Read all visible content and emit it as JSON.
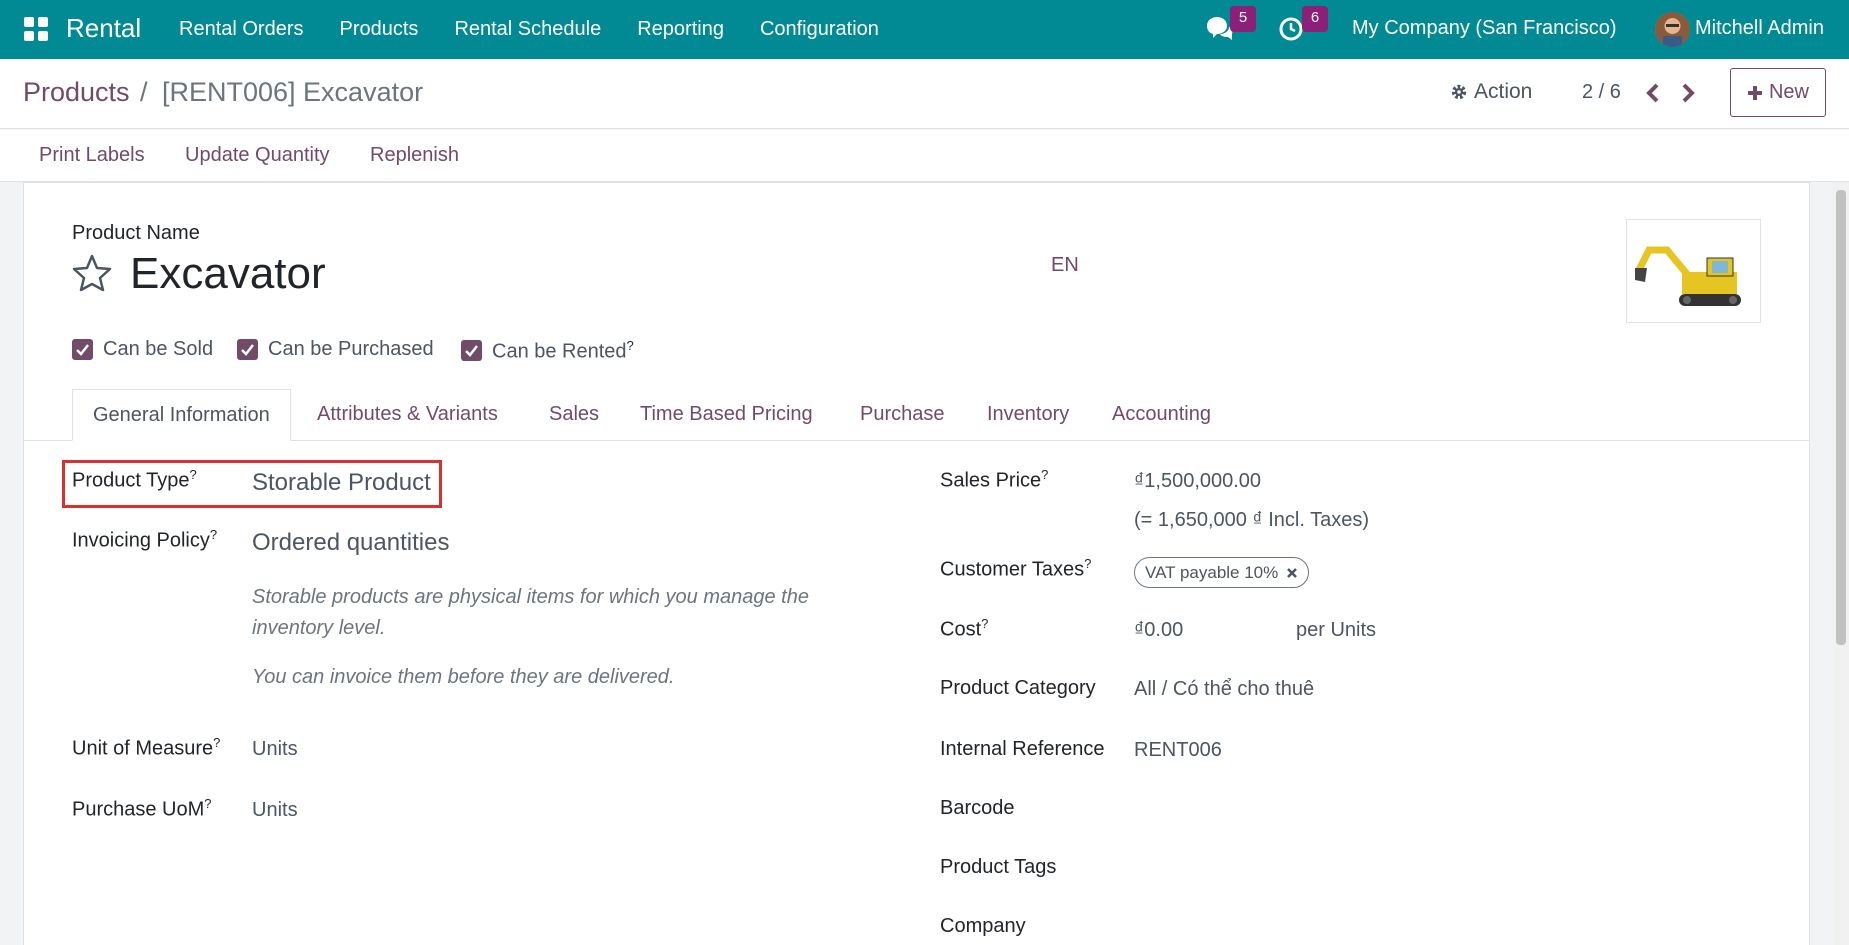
{
  "navbar": {
    "app_name": "Rental",
    "menu": [
      "Rental Orders",
      "Products",
      "Rental Schedule",
      "Reporting",
      "Configuration"
    ],
    "messages_count": "5",
    "activities_count": "6",
    "company": "My Company (San Francisco)",
    "user": "Mitchell Admin"
  },
  "control": {
    "breadcrumb_parent": "Products",
    "breadcrumb_sep": "/",
    "breadcrumb_current": "[RENT006] Excavator",
    "action_label": "Action",
    "pager": "2 / 6",
    "new_label": "New"
  },
  "statusbar": {
    "buttons": [
      "Print Labels",
      "Update Quantity",
      "Replenish"
    ]
  },
  "form": {
    "name_label": "Product Name",
    "name": "Excavator",
    "lang": "EN",
    "checkboxes": [
      {
        "label": "Can be Sold",
        "checked": true
      },
      {
        "label": "Can be Purchased",
        "checked": true
      },
      {
        "label": "Can be Rented",
        "checked": true,
        "help": "?"
      }
    ],
    "tabs": [
      "General Information",
      "Attributes & Variants",
      "Sales",
      "Time Based Pricing",
      "Purchase",
      "Inventory",
      "Accounting"
    ],
    "left": {
      "product_type_label": "Product Type",
      "product_type": "Storable Product",
      "invoicing_policy_label": "Invoicing Policy",
      "invoicing_policy": "Ordered quantities",
      "help_line1": "Storable products are physical items for which you manage the inventory level.",
      "help_line2": "You can invoice them before they are delivered.",
      "uom_label": "Unit of Measure",
      "uom": "Units",
      "purchase_uom_label": "Purchase UoM",
      "purchase_uom": "Units"
    },
    "right": {
      "sales_price_label": "Sales Price",
      "sales_price": "₫1,500,000.00",
      "incl_taxes": "(= 1,650,000 ₫ Incl. Taxes)",
      "customer_taxes_label": "Customer Taxes",
      "customer_tax_tag": "VAT payable 10%",
      "cost_label": "Cost",
      "cost": "₫0.00",
      "cost_unit": "per Units",
      "category_label": "Product Category",
      "category": "All / Có thể cho thuê",
      "internal_ref_label": "Internal Reference",
      "internal_ref": "RENT006",
      "barcode_label": "Barcode",
      "tags_label": "Product Tags",
      "company_label": "Company"
    },
    "help_marker": "?"
  },
  "colors": {
    "navbar": "#018a94",
    "accent": "#714b67",
    "badge": "#8c1f78",
    "highlight": "#d9312f"
  }
}
